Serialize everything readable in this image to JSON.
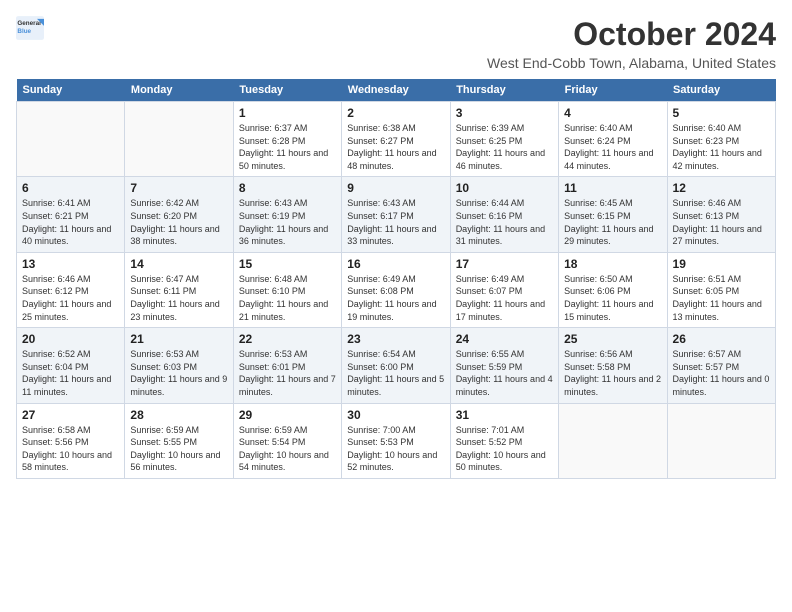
{
  "logo": {
    "general": "General",
    "blue": "Blue"
  },
  "title": "October 2024",
  "subtitle": "West End-Cobb Town, Alabama, United States",
  "days_of_week": [
    "Sunday",
    "Monday",
    "Tuesday",
    "Wednesday",
    "Thursday",
    "Friday",
    "Saturday"
  ],
  "weeks": [
    [
      {
        "day": "",
        "sunrise": "",
        "sunset": "",
        "daylight": ""
      },
      {
        "day": "",
        "sunrise": "",
        "sunset": "",
        "daylight": ""
      },
      {
        "day": "1",
        "sunrise": "Sunrise: 6:37 AM",
        "sunset": "Sunset: 6:28 PM",
        "daylight": "Daylight: 11 hours and 50 minutes."
      },
      {
        "day": "2",
        "sunrise": "Sunrise: 6:38 AM",
        "sunset": "Sunset: 6:27 PM",
        "daylight": "Daylight: 11 hours and 48 minutes."
      },
      {
        "day": "3",
        "sunrise": "Sunrise: 6:39 AM",
        "sunset": "Sunset: 6:25 PM",
        "daylight": "Daylight: 11 hours and 46 minutes."
      },
      {
        "day": "4",
        "sunrise": "Sunrise: 6:40 AM",
        "sunset": "Sunset: 6:24 PM",
        "daylight": "Daylight: 11 hours and 44 minutes."
      },
      {
        "day": "5",
        "sunrise": "Sunrise: 6:40 AM",
        "sunset": "Sunset: 6:23 PM",
        "daylight": "Daylight: 11 hours and 42 minutes."
      }
    ],
    [
      {
        "day": "6",
        "sunrise": "Sunrise: 6:41 AM",
        "sunset": "Sunset: 6:21 PM",
        "daylight": "Daylight: 11 hours and 40 minutes."
      },
      {
        "day": "7",
        "sunrise": "Sunrise: 6:42 AM",
        "sunset": "Sunset: 6:20 PM",
        "daylight": "Daylight: 11 hours and 38 minutes."
      },
      {
        "day": "8",
        "sunrise": "Sunrise: 6:43 AM",
        "sunset": "Sunset: 6:19 PM",
        "daylight": "Daylight: 11 hours and 36 minutes."
      },
      {
        "day": "9",
        "sunrise": "Sunrise: 6:43 AM",
        "sunset": "Sunset: 6:17 PM",
        "daylight": "Daylight: 11 hours and 33 minutes."
      },
      {
        "day": "10",
        "sunrise": "Sunrise: 6:44 AM",
        "sunset": "Sunset: 6:16 PM",
        "daylight": "Daylight: 11 hours and 31 minutes."
      },
      {
        "day": "11",
        "sunrise": "Sunrise: 6:45 AM",
        "sunset": "Sunset: 6:15 PM",
        "daylight": "Daylight: 11 hours and 29 minutes."
      },
      {
        "day": "12",
        "sunrise": "Sunrise: 6:46 AM",
        "sunset": "Sunset: 6:13 PM",
        "daylight": "Daylight: 11 hours and 27 minutes."
      }
    ],
    [
      {
        "day": "13",
        "sunrise": "Sunrise: 6:46 AM",
        "sunset": "Sunset: 6:12 PM",
        "daylight": "Daylight: 11 hours and 25 minutes."
      },
      {
        "day": "14",
        "sunrise": "Sunrise: 6:47 AM",
        "sunset": "Sunset: 6:11 PM",
        "daylight": "Daylight: 11 hours and 23 minutes."
      },
      {
        "day": "15",
        "sunrise": "Sunrise: 6:48 AM",
        "sunset": "Sunset: 6:10 PM",
        "daylight": "Daylight: 11 hours and 21 minutes."
      },
      {
        "day": "16",
        "sunrise": "Sunrise: 6:49 AM",
        "sunset": "Sunset: 6:08 PM",
        "daylight": "Daylight: 11 hours and 19 minutes."
      },
      {
        "day": "17",
        "sunrise": "Sunrise: 6:49 AM",
        "sunset": "Sunset: 6:07 PM",
        "daylight": "Daylight: 11 hours and 17 minutes."
      },
      {
        "day": "18",
        "sunrise": "Sunrise: 6:50 AM",
        "sunset": "Sunset: 6:06 PM",
        "daylight": "Daylight: 11 hours and 15 minutes."
      },
      {
        "day": "19",
        "sunrise": "Sunrise: 6:51 AM",
        "sunset": "Sunset: 6:05 PM",
        "daylight": "Daylight: 11 hours and 13 minutes."
      }
    ],
    [
      {
        "day": "20",
        "sunrise": "Sunrise: 6:52 AM",
        "sunset": "Sunset: 6:04 PM",
        "daylight": "Daylight: 11 hours and 11 minutes."
      },
      {
        "day": "21",
        "sunrise": "Sunrise: 6:53 AM",
        "sunset": "Sunset: 6:03 PM",
        "daylight": "Daylight: 11 hours and 9 minutes."
      },
      {
        "day": "22",
        "sunrise": "Sunrise: 6:53 AM",
        "sunset": "Sunset: 6:01 PM",
        "daylight": "Daylight: 11 hours and 7 minutes."
      },
      {
        "day": "23",
        "sunrise": "Sunrise: 6:54 AM",
        "sunset": "Sunset: 6:00 PM",
        "daylight": "Daylight: 11 hours and 5 minutes."
      },
      {
        "day": "24",
        "sunrise": "Sunrise: 6:55 AM",
        "sunset": "Sunset: 5:59 PM",
        "daylight": "Daylight: 11 hours and 4 minutes."
      },
      {
        "day": "25",
        "sunrise": "Sunrise: 6:56 AM",
        "sunset": "Sunset: 5:58 PM",
        "daylight": "Daylight: 11 hours and 2 minutes."
      },
      {
        "day": "26",
        "sunrise": "Sunrise: 6:57 AM",
        "sunset": "Sunset: 5:57 PM",
        "daylight": "Daylight: 11 hours and 0 minutes."
      }
    ],
    [
      {
        "day": "27",
        "sunrise": "Sunrise: 6:58 AM",
        "sunset": "Sunset: 5:56 PM",
        "daylight": "Daylight: 10 hours and 58 minutes."
      },
      {
        "day": "28",
        "sunrise": "Sunrise: 6:59 AM",
        "sunset": "Sunset: 5:55 PM",
        "daylight": "Daylight: 10 hours and 56 minutes."
      },
      {
        "day": "29",
        "sunrise": "Sunrise: 6:59 AM",
        "sunset": "Sunset: 5:54 PM",
        "daylight": "Daylight: 10 hours and 54 minutes."
      },
      {
        "day": "30",
        "sunrise": "Sunrise: 7:00 AM",
        "sunset": "Sunset: 5:53 PM",
        "daylight": "Daylight: 10 hours and 52 minutes."
      },
      {
        "day": "31",
        "sunrise": "Sunrise: 7:01 AM",
        "sunset": "Sunset: 5:52 PM",
        "daylight": "Daylight: 10 hours and 50 minutes."
      },
      {
        "day": "",
        "sunrise": "",
        "sunset": "",
        "daylight": ""
      },
      {
        "day": "",
        "sunrise": "",
        "sunset": "",
        "daylight": ""
      }
    ]
  ]
}
